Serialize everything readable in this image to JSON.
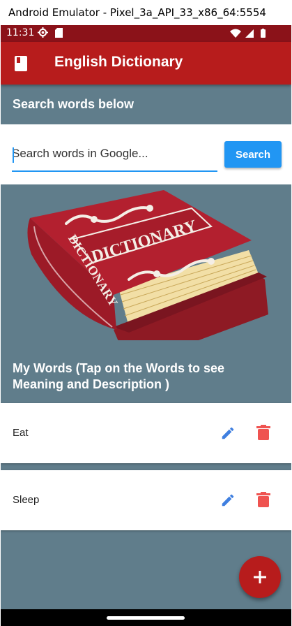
{
  "window": {
    "title": "Android Emulator - Pixel_3a_API_33_x86_64:5554"
  },
  "status_bar": {
    "time": "11:31"
  },
  "app_bar": {
    "title": "English Dictionary",
    "icon": "book-icon",
    "color": "#b71c1c"
  },
  "search": {
    "heading": "Search words below",
    "placeholder": "Search words in Google...",
    "button_label": "Search",
    "accent": "#2196f3"
  },
  "image": {
    "text_top": "DICTIONARY",
    "text_spine": "DICTIONARY"
  },
  "my_words": {
    "heading": "My Words (Tap on the Words to see Meaning and Description )",
    "items": [
      {
        "word": "Eat",
        "edit_icon": "pencil-icon",
        "delete_icon": "trash-icon"
      },
      {
        "word": "Sleep",
        "edit_icon": "pencil-icon",
        "delete_icon": "trash-icon"
      }
    ]
  },
  "fab": {
    "icon": "plus-icon"
  },
  "colors": {
    "background": "#607d8b",
    "edit": "#3f7fe0",
    "delete": "#ef5350"
  }
}
